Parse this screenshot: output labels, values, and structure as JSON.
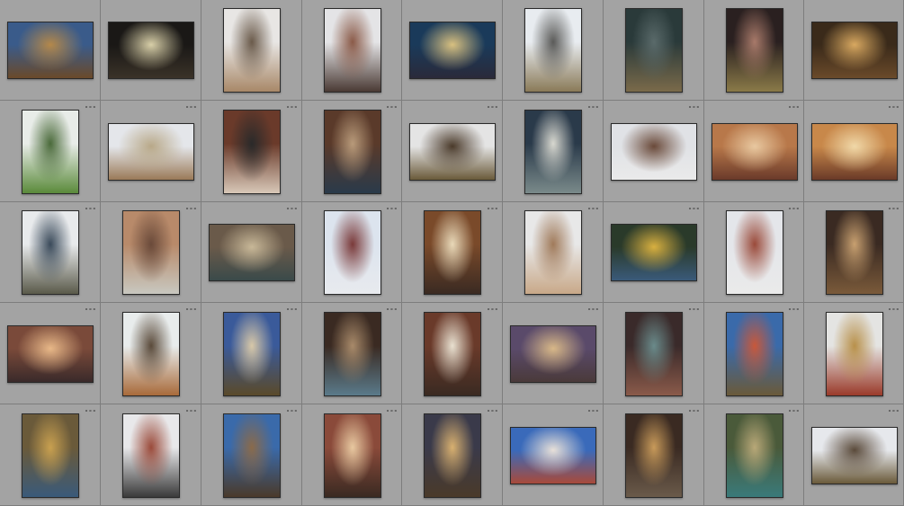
{
  "grid": {
    "rows": 5,
    "cols": 9,
    "cell_badge": "∘∘∘"
  },
  "photos": [
    {
      "orientation": "landscape",
      "tones": [
        "#3a5b8a",
        "#b4884a",
        "#6a4a2a"
      ]
    },
    {
      "orientation": "landscape",
      "tones": [
        "#1a1816",
        "#d8cfa8",
        "#3a3228"
      ]
    },
    {
      "orientation": "portrait",
      "tones": [
        "#e8e6e4",
        "#6a5a4a",
        "#a88868"
      ]
    },
    {
      "orientation": "portrait",
      "tones": [
        "#e4e4e6",
        "#8a5a48",
        "#4a3a34"
      ]
    },
    {
      "orientation": "landscape",
      "tones": [
        "#1a3a5a",
        "#d8c080",
        "#2a2a3a"
      ]
    },
    {
      "orientation": "portrait",
      "tones": [
        "#e8ecf0",
        "#5a5a58",
        "#8a7a58"
      ]
    },
    {
      "orientation": "portrait",
      "tones": [
        "#2a3a3a",
        "#5a6a6a",
        "#7a6a4a"
      ]
    },
    {
      "orientation": "portrait",
      "tones": [
        "#2a2020",
        "#a87a6a",
        "#8a7a48"
      ]
    },
    {
      "orientation": "landscape",
      "tones": [
        "#3a2a1a",
        "#d8a860",
        "#6a4a2a"
      ]
    },
    {
      "orientation": "portrait",
      "tones": [
        "#e8ece8",
        "#4a6a3a",
        "#5a8a3a"
      ]
    },
    {
      "orientation": "landscape",
      "tones": [
        "#e4e6ea",
        "#b8a888",
        "#9a7a58"
      ]
    },
    {
      "orientation": "portrait",
      "tones": [
        "#6a3a2a",
        "#2a2a2a",
        "#d8c8b8"
      ]
    },
    {
      "orientation": "portrait",
      "tones": [
        "#5a3a2a",
        "#b89a7a",
        "#2a3a4a"
      ]
    },
    {
      "orientation": "landscape",
      "tones": [
        "#e4e4e4",
        "#4a3a2a",
        "#6a5a3a"
      ]
    },
    {
      "orientation": "portrait",
      "tones": [
        "#2a3a4a",
        "#d8d8d0",
        "#7a8a8a"
      ]
    },
    {
      "orientation": "landscape",
      "tones": [
        "#e0e2e6",
        "#6a4a3a",
        "#eaeaea"
      ]
    },
    {
      "orientation": "landscape",
      "tones": [
        "#b8784a",
        "#e8c8a0",
        "#6a3a2a"
      ]
    },
    {
      "orientation": "landscape",
      "tones": [
        "#c8884a",
        "#f0d8a8",
        "#6a3a28"
      ]
    },
    {
      "orientation": "portrait",
      "tones": [
        "#e8eaec",
        "#3a4a5a",
        "#5a5a4a"
      ]
    },
    {
      "orientation": "portrait",
      "tones": [
        "#b88a6a",
        "#6a4a3a",
        "#c8c8c0"
      ]
    },
    {
      "orientation": "landscape",
      "tones": [
        "#6a5a4a",
        "#c8b898",
        "#3a4a4a"
      ]
    },
    {
      "orientation": "portrait",
      "tones": [
        "#dce4ee",
        "#7a3a3a",
        "#e8eaee"
      ]
    },
    {
      "orientation": "portrait",
      "tones": [
        "#7a4a2a",
        "#e8d8b8",
        "#3a2a22"
      ]
    },
    {
      "orientation": "portrait",
      "tones": [
        "#e8e8e8",
        "#a07a5a",
        "#c8a888"
      ]
    },
    {
      "orientation": "landscape",
      "tones": [
        "#2a3a2a",
        "#d8b040",
        "#3a5a7a"
      ]
    },
    {
      "orientation": "portrait",
      "tones": [
        "#e4e6ea",
        "#9a4a3a",
        "#eaeaea"
      ]
    },
    {
      "orientation": "portrait",
      "tones": [
        "#3a2a22",
        "#c8a070",
        "#7a5a3a"
      ]
    },
    {
      "orientation": "landscape",
      "tones": [
        "#7a4a3a",
        "#e8b888",
        "#3a2a2a"
      ]
    },
    {
      "orientation": "portrait",
      "tones": [
        "#e8ecec",
        "#5a4a3a",
        "#a86a3a"
      ]
    },
    {
      "orientation": "portrait",
      "tones": [
        "#3a5a9a",
        "#d8c8a8",
        "#5a4a2a"
      ]
    },
    {
      "orientation": "portrait",
      "tones": [
        "#3a2a22",
        "#a88a6a",
        "#5a7a8a"
      ]
    },
    {
      "orientation": "portrait",
      "tones": [
        "#6a3a2a",
        "#e8e0d0",
        "#3a2a22"
      ]
    },
    {
      "orientation": "landscape",
      "tones": [
        "#5a4a6a",
        "#d8b888",
        "#4a3a3a"
      ]
    },
    {
      "orientation": "portrait",
      "tones": [
        "#3a2a2a",
        "#6a8a8a",
        "#8a5a4a"
      ]
    },
    {
      "orientation": "portrait",
      "tones": [
        "#3a6aaa",
        "#c8583a",
        "#6a5a3a"
      ]
    },
    {
      "orientation": "portrait",
      "tones": [
        "#e4e4e2",
        "#b8904a",
        "#9a3a2a"
      ]
    },
    {
      "orientation": "portrait",
      "tones": [
        "#6a5a3a",
        "#c8a050",
        "#3a5a7a"
      ]
    },
    {
      "orientation": "portrait",
      "tones": [
        "#e8e8ea",
        "#9a4a3a",
        "#3a3a3a"
      ]
    },
    {
      "orientation": "portrait",
      "tones": [
        "#3a6aaa",
        "#8a6a4a",
        "#4a3a2a"
      ]
    },
    {
      "orientation": "portrait",
      "tones": [
        "#8a4a3a",
        "#e8c8a0",
        "#3a2a22"
      ]
    },
    {
      "orientation": "portrait",
      "tones": [
        "#3a3a4a",
        "#d8b070",
        "#4a3a2a"
      ]
    },
    {
      "orientation": "landscape",
      "tones": [
        "#3a6aba",
        "#e8e0d8",
        "#a84a3a"
      ]
    },
    {
      "orientation": "portrait",
      "tones": [
        "#3a2a22",
        "#c89a5a",
        "#6a5a4a"
      ]
    },
    {
      "orientation": "portrait",
      "tones": [
        "#4a5a3a",
        "#b8a878",
        "#3a7a7a"
      ]
    },
    {
      "orientation": "landscape",
      "tones": [
        "#e6e8ec",
        "#5a4a3a",
        "#6a5a3a"
      ]
    }
  ]
}
